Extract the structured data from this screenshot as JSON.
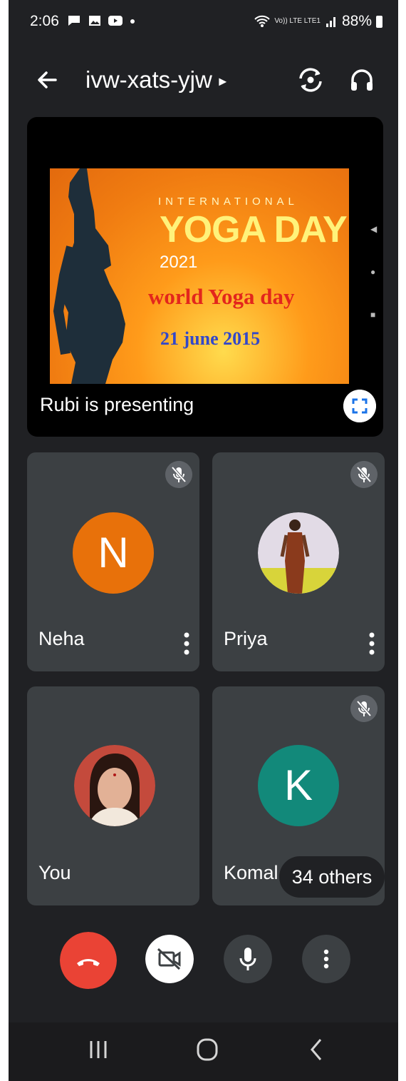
{
  "status_bar": {
    "time": "2:06",
    "notification_icons": [
      "chat-icon",
      "image-icon",
      "youtube-icon"
    ],
    "network": "Vo)) LTE LTE1",
    "battery": "88%"
  },
  "header": {
    "meeting_code": "ivw-xats-yjw",
    "icons": [
      "back-arrow-icon",
      "switch-camera-icon",
      "headphones-icon"
    ]
  },
  "presentation": {
    "slide": {
      "line1": "INTERNATIONAL",
      "line2": "YOGA DAY",
      "line3": "2021",
      "line4": "world Yoga day",
      "line5": "21 june 2015"
    },
    "presenter_text": "Rubi is presenting"
  },
  "participants": [
    {
      "name": "Neha",
      "initial": "N",
      "avatar_color": "#e8710a",
      "muted": true
    },
    {
      "name": "Priya",
      "initial": "",
      "avatar_color": "#e0d8e8",
      "muted": true
    },
    {
      "name": "You",
      "initial": "",
      "avatar_color": "#c44a3c",
      "muted": false
    },
    {
      "name": "Komal",
      "initial": "K",
      "avatar_color": "#12897a",
      "muted": true
    }
  ],
  "others_count": "34 others",
  "controls": {
    "end_call_color": "#ea4335",
    "buttons": [
      "end-call-icon",
      "camera-off-icon",
      "microphone-icon",
      "more-options-icon"
    ]
  },
  "colors": {
    "background": "#202124",
    "tile": "#3c4043"
  }
}
